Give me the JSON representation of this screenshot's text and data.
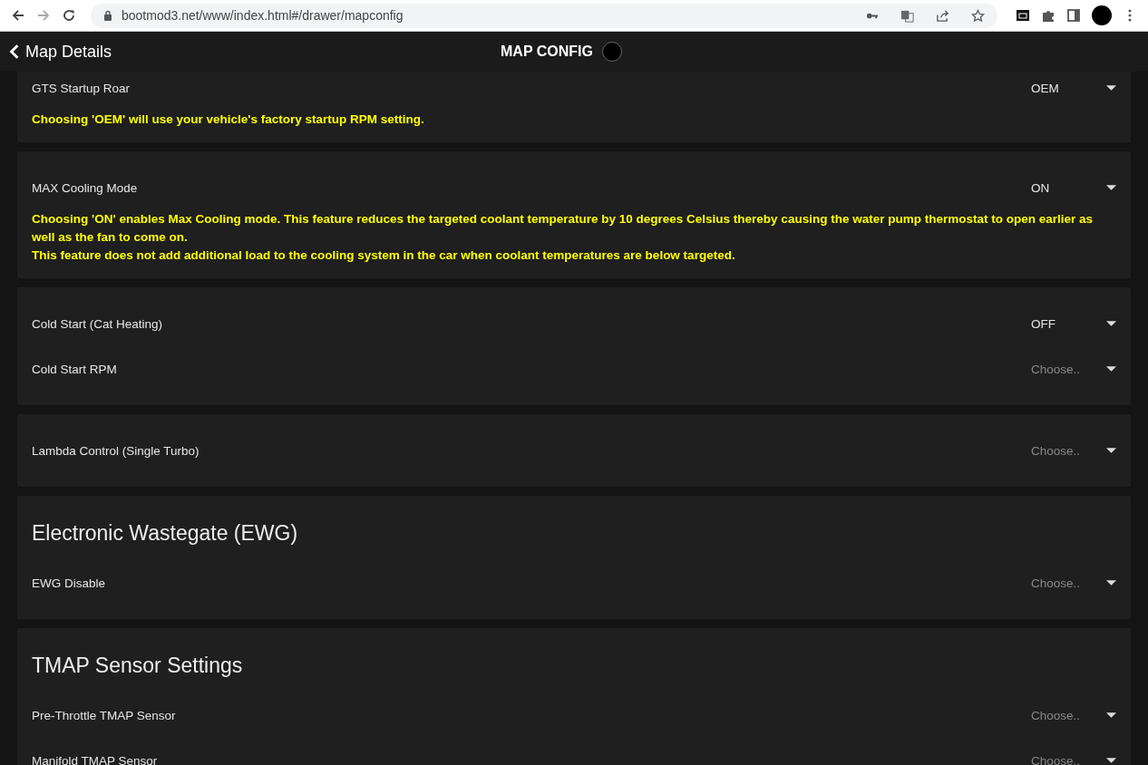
{
  "browser": {
    "url": "bootmod3.net/www/index.html#/drawer/mapconfig"
  },
  "header": {
    "back_label": "Map Details",
    "title": "MAP CONFIG"
  },
  "cards": [
    {
      "rows": [
        {
          "label": "GTS Startup Roar",
          "value": "OEM"
        }
      ],
      "notes": [
        "Choosing 'OEM' will use your vehicle's factory startup RPM setting."
      ]
    },
    {
      "rows": [
        {
          "label": "MAX Cooling Mode",
          "value": "ON"
        }
      ],
      "notes": [
        "Choosing 'ON' enables Max Cooling mode. This feature reduces the targeted coolant temperature by 10 degrees Celsius thereby causing the water pump thermostat to open earlier as well as the fan to come on.",
        "This feature does not add additional load to the cooling system in the car when coolant temperatures are below targeted."
      ]
    },
    {
      "rows": [
        {
          "label": "Cold Start (Cat Heating)",
          "value": "OFF"
        },
        {
          "label": "Cold Start RPM",
          "placeholder": "Choose.."
        }
      ]
    },
    {
      "rows": [
        {
          "label": "Lambda Control (Single Turbo)",
          "placeholder": "Choose.."
        }
      ]
    },
    {
      "heading": "Electronic Wastegate (EWG)",
      "rows": [
        {
          "label": "EWG Disable",
          "placeholder": "Choose.."
        }
      ]
    },
    {
      "heading": "TMAP Sensor Settings",
      "rows": [
        {
          "label": "Pre-Throttle TMAP Sensor",
          "placeholder": "Choose.."
        },
        {
          "label": "Manifold TMAP Sensor",
          "placeholder": "Choose.."
        }
      ]
    }
  ]
}
